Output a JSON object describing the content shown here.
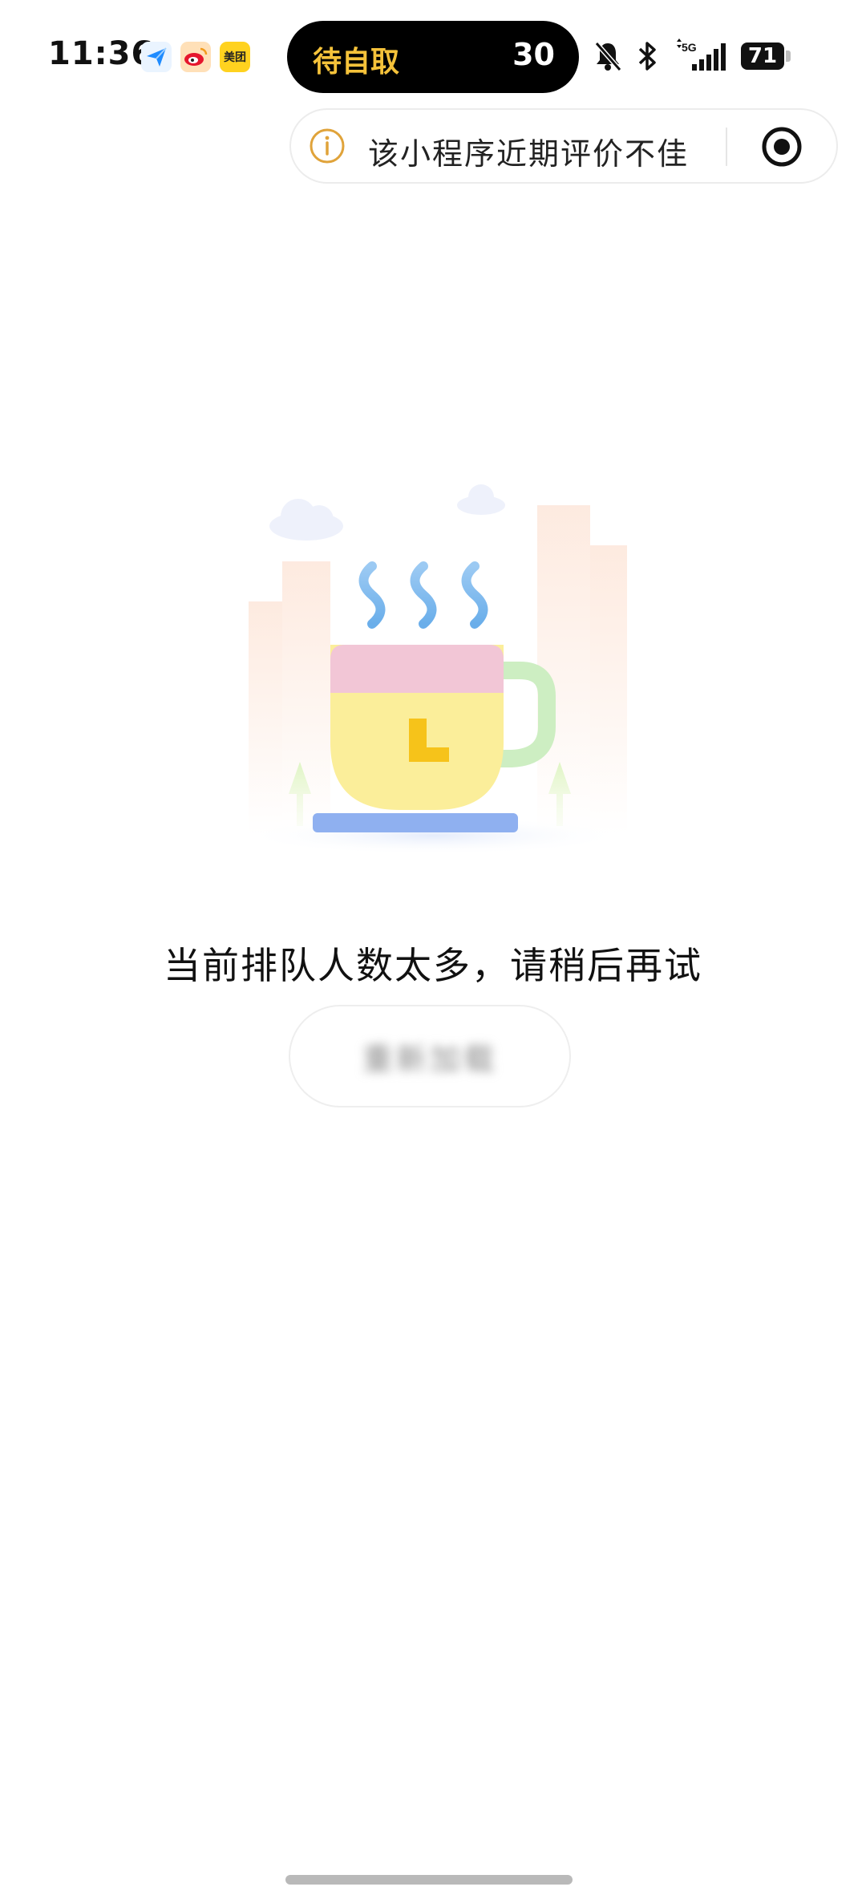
{
  "status_bar": {
    "time": "11:36",
    "apps": [
      "maps-icon",
      "weibo-icon",
      "meituan-icon"
    ],
    "meituan_label": "美团",
    "signal_label": "5G",
    "battery_level": "71"
  },
  "dynamic_island": {
    "label": "待自取",
    "count": "30"
  },
  "notice": {
    "text": "该小程序近期评价不佳"
  },
  "main": {
    "message": "当前排队人数太多，请稍后再试",
    "retry_label": "重新加载"
  },
  "colors": {
    "island_label": "#f5c23a",
    "info_icon": "#e0a33a",
    "cup_body": "#fbee9a",
    "cup_rim": "#f2c6d6",
    "saucer": "#8fb0f0"
  }
}
